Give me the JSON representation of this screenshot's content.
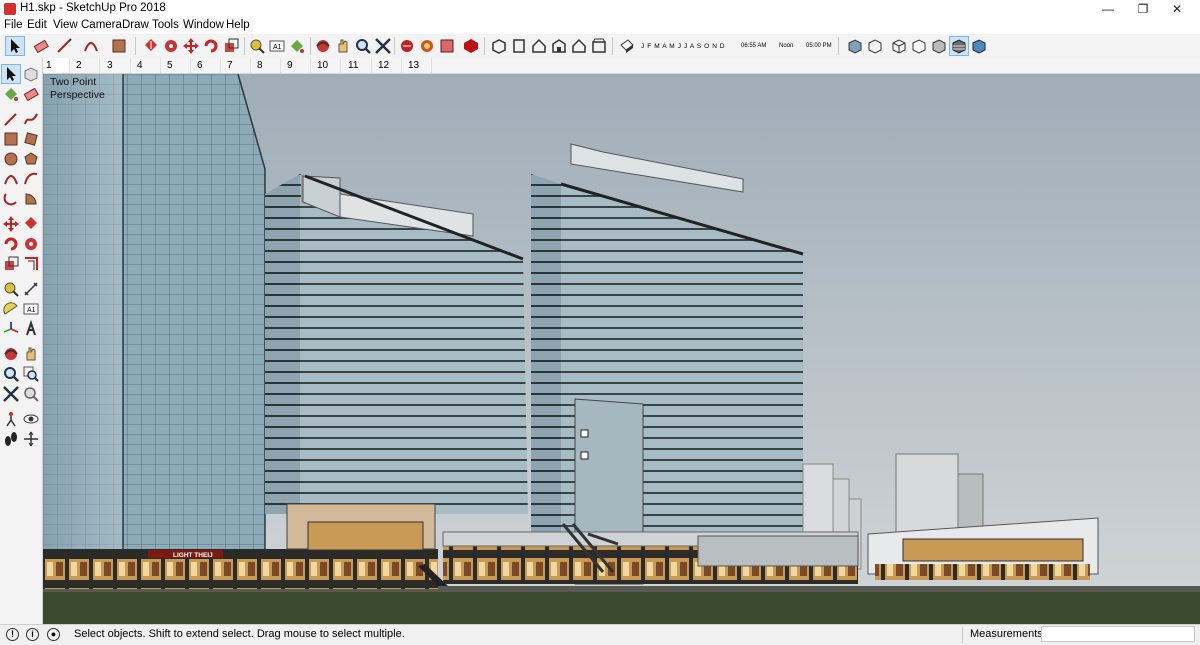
{
  "window": {
    "title": "H1.skp - SketchUp Pro 2018",
    "controls": {
      "minimize": "—",
      "maximize": "❐",
      "close": "✕"
    }
  },
  "menu": [
    "File",
    "Edit",
    "View",
    "Camera",
    "Draw",
    "Tools",
    "Window",
    "Help"
  ],
  "shadow_settings": {
    "months": "J F M A M J J A S O N D",
    "time_start": "06:55 AM",
    "time_noon": "Noon",
    "time_end": "05:00 PM"
  },
  "scenes": [
    "1",
    "2",
    "3",
    "4",
    "5",
    "6",
    "7",
    "8",
    "9",
    "10",
    "11",
    "12",
    "13"
  ],
  "active_scene": "1",
  "viewport": {
    "camera_label_line1": "Two Point",
    "camera_label_line2": "Perspective",
    "sign_text": "LIGHT THEIJ"
  },
  "status": {
    "message": "Select objects. Shift to extend select. Drag mouse to select multiple.",
    "measurements_label": "Measurements",
    "measurements_value": ""
  },
  "colors": {
    "sky": "#b8c2ca",
    "ground": "#3b4a2c",
    "glass": "#9fb6c2",
    "selection": "#cde4f7"
  }
}
